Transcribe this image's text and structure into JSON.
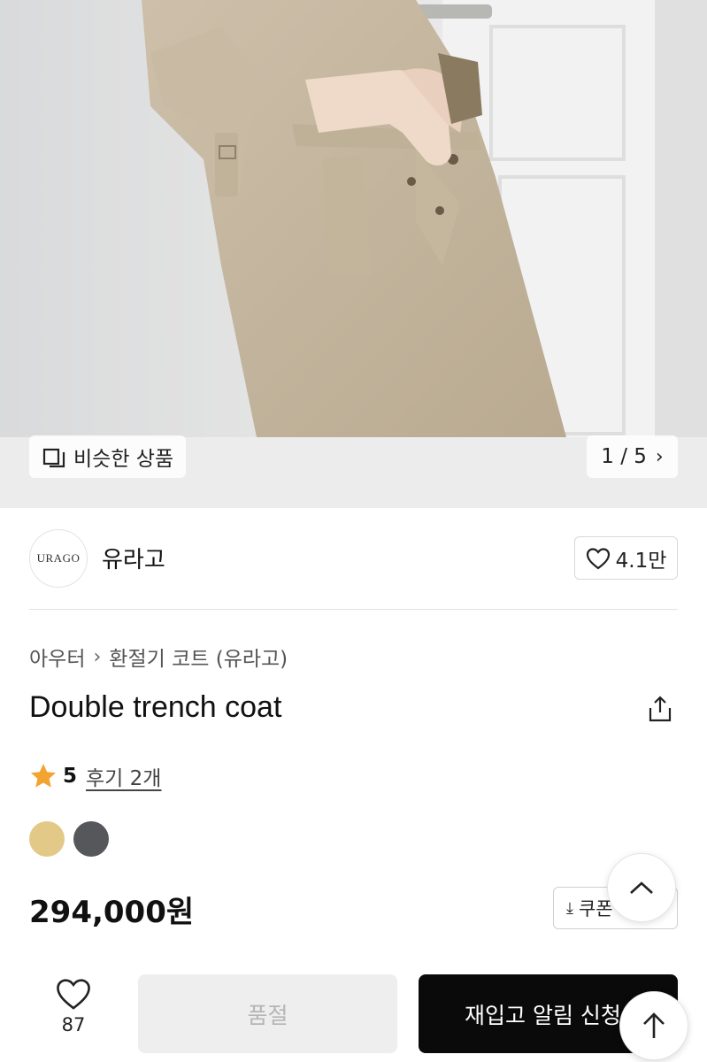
{
  "gallery": {
    "similar_label": "비슷한 상품",
    "pager_text": "1 / 5",
    "current": 1,
    "total": 5
  },
  "brand": {
    "logo_text": "URAGO",
    "name": "유라고",
    "likes": "4.1만"
  },
  "breadcrumb": [
    "아우터",
    "환절기 코트 (유라고)"
  ],
  "product": {
    "title": "Double trench coat",
    "rating": "5",
    "reviews_label": "후기 2개",
    "colors": [
      "#E3C987",
      "#55575A"
    ],
    "price": "294,000원",
    "coupon_label": "쿠폰"
  },
  "bottom_bar": {
    "wish_count": "87",
    "soldout_label": "품절",
    "notify_label": "재입고 알림 신청"
  },
  "icons": {
    "similar": "similar-products-icon",
    "pager": "chevron-right-icon",
    "like": "heart-outline-icon",
    "share": "share-icon",
    "star": "star-icon",
    "download": "download-icon",
    "up": "chevron-up-icon",
    "arrow_up": "arrow-up-icon"
  },
  "accent": {
    "star": "#F3A330",
    "primary_button": "#0A0A0A"
  }
}
